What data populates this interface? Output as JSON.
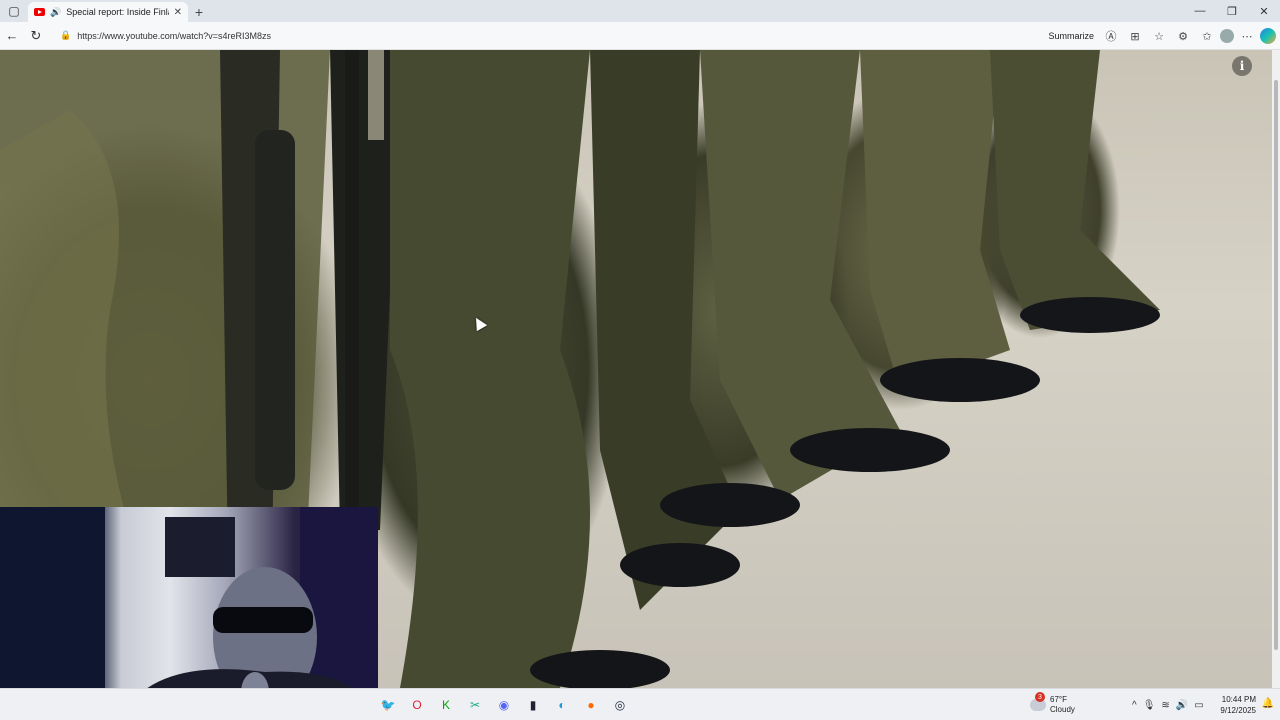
{
  "browser": {
    "tab_title": "Special report: Inside Finland",
    "tab_close": "✕",
    "new_tab": "+",
    "url": "https://www.youtube.com/watch?v=s4reRI3M8zs",
    "summarize_label": "Summarize",
    "window_controls": {
      "minimize": "—",
      "restore": "❐",
      "close": "✕"
    },
    "nav": {
      "back": "←",
      "reload": "↻"
    }
  },
  "video": {
    "info_glyph": "i"
  },
  "taskbar": {
    "apps": [
      {
        "name": "twitter-app",
        "glyph": "🐦",
        "color": "#1d9bf0"
      },
      {
        "name": "opera-app",
        "glyph": "O",
        "color": "#e0243a"
      },
      {
        "name": "kick-app",
        "glyph": "K",
        "color": "#0a0"
      },
      {
        "name": "snipping-app",
        "glyph": "✂",
        "color": "#2a8"
      },
      {
        "name": "discord-app",
        "glyph": "◉",
        "color": "#5865f2"
      },
      {
        "name": "terminal-app",
        "glyph": "▮",
        "color": "#223"
      },
      {
        "name": "edge-app",
        "glyph": "◐",
        "color": "#1b9ad6"
      },
      {
        "name": "firefox-app",
        "glyph": "●",
        "color": "#ff6a00"
      },
      {
        "name": "steam-app",
        "glyph": "◎",
        "color": "#1b2838"
      }
    ],
    "weather": {
      "badge": "3",
      "temp": "67°F",
      "condition": "Cloudy"
    },
    "tray": {
      "chevron": "^",
      "mic": "🎙",
      "wifi": "≋",
      "volume": "🔊",
      "battery": "▭"
    },
    "clock": {
      "time": "10:44 PM",
      "date": "9/12/2025"
    }
  }
}
